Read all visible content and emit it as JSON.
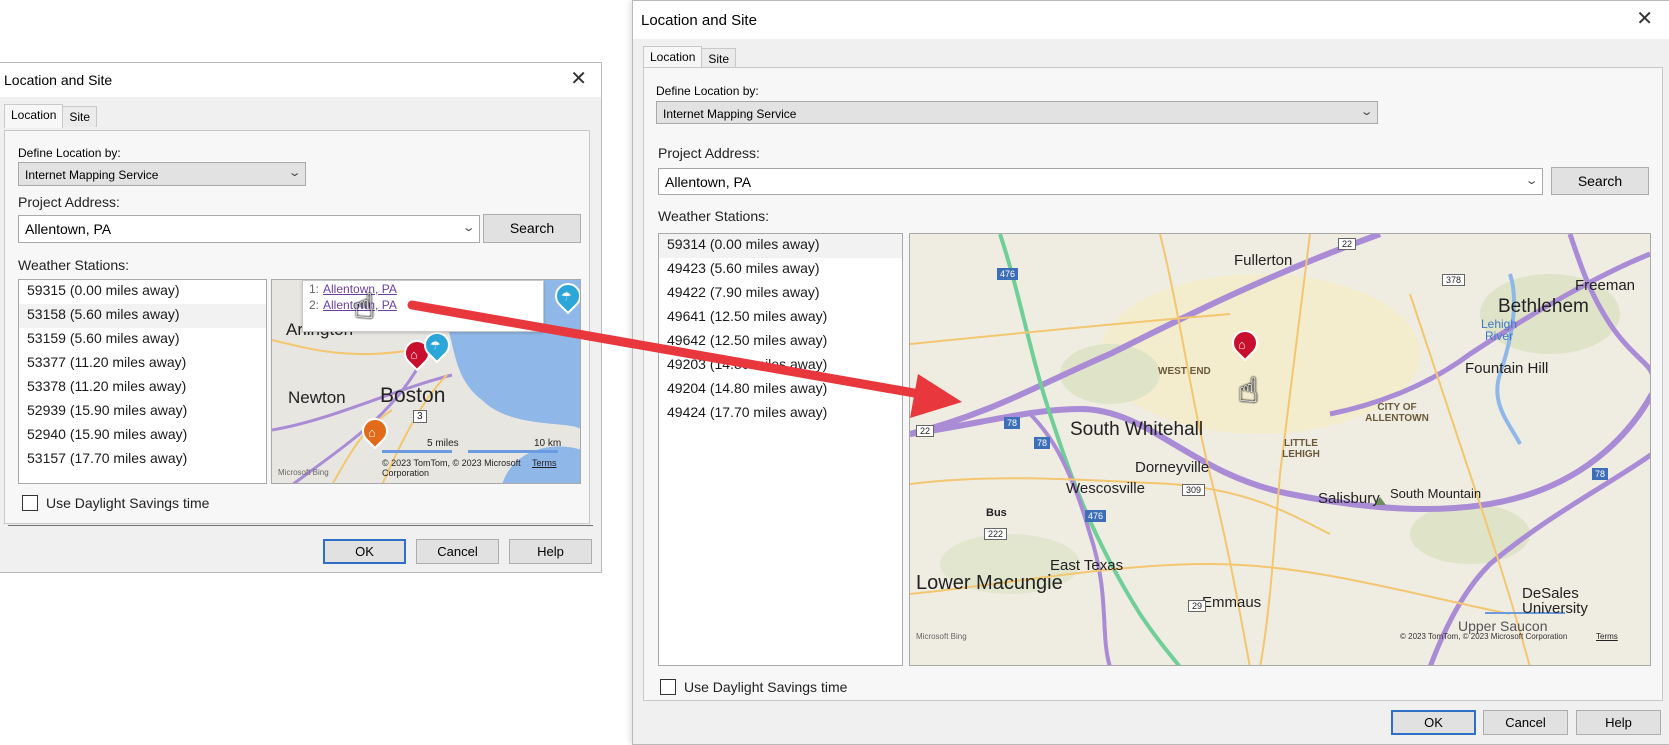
{
  "small": {
    "title": "Location and Site",
    "tabs": [
      "Location",
      "Site"
    ],
    "define_label": "Define Location by:",
    "define_value": "Internet Mapping Service",
    "address_label": "Project Address:",
    "address_value": "Allentown, PA",
    "search_label": "Search",
    "stations_label": "Weather Stations:",
    "stations": [
      "59315 (0.00 miles away)",
      "53158 (5.60 miles away)",
      "53159 (5.60 miles away)",
      "53377 (11.20 miles away)",
      "53378 (11.20 miles away)",
      "52939 (15.90 miles away)",
      "52940 (15.90 miles away)",
      "53157 (17.70 miles away)"
    ],
    "selected_index": 1,
    "daylight_label": "Use Daylight Savings time",
    "ok_label": "OK",
    "cancel_label": "Cancel",
    "help_label": "Help",
    "map": {
      "popup": [
        {
          "num": "1:",
          "text": "Allentown, PA"
        },
        {
          "num": "2:",
          "text": "Allentown, PA"
        }
      ],
      "places": [
        "Arlington",
        "Newton",
        "Boston"
      ],
      "road": "3",
      "scale_miles": "5 miles",
      "scale_km": "10 km",
      "copyright": "© 2023 TomTom, © 2023 Microsoft Corporation",
      "terms": "Terms",
      "brand": "Microsoft Bing"
    }
  },
  "large": {
    "title": "Location and Site",
    "tabs": [
      "Location",
      "Site"
    ],
    "define_label": "Define Location by:",
    "define_value": "Internet Mapping Service",
    "address_label": "Project Address:",
    "address_value": "Allentown, PA",
    "search_label": "Search",
    "stations_label": "Weather Stations:",
    "stations": [
      "59314 (0.00 miles away)",
      "49423 (5.60 miles away)",
      "49422 (7.90 miles away)",
      "49641 (12.50 miles away)",
      "49642 (12.50 miles away)",
      "49203 (14.80 miles away)",
      "49204 (14.80 miles away)",
      "49424 (17.70 miles away)"
    ],
    "selected_index": 0,
    "daylight_label": "Use Daylight Savings time",
    "ok_label": "OK",
    "cancel_label": "Cancel",
    "help_label": "Help",
    "map": {
      "places": {
        "fullerton": "Fullerton",
        "freeman": "Freeman",
        "bethlehem": "Bethlehem",
        "lehigh_river": "Lehigh River",
        "fountain_hill": "Fountain Hill",
        "west_end": "WEST END",
        "city_of_allentown": "CITY OF ALLENTOWN",
        "south_whitehall": "South Whitehall",
        "little_lehigh": "LITTLE LEHIGH",
        "dorneyville": "Dorneyville",
        "wescosville": "Wescosville",
        "salisbury": "Salisbury",
        "south_mountain": "South Mountain",
        "bus": "Bus",
        "east_texas": "East Texas",
        "lower_macungie": "Lower Macungie",
        "emmaus": "Emmaus",
        "desales": "DeSales University",
        "upper_saucon": "Upper Saucon"
      },
      "roads": {
        "r476a": "476",
        "r22a": "22",
        "r378": "378",
        "r22b": "22",
        "r78a": "78",
        "r78b": "78",
        "r309": "309",
        "r476b": "476",
        "r222": "222",
        "r29": "29",
        "r78c": "78"
      },
      "copyright": "© 2023 TomTom, © 2023 Microsoft Corporation",
      "terms": "Terms",
      "brand": "Microsoft Bing"
    }
  },
  "colors": {
    "arrow": "#e8373d",
    "road_purple": "#a98bd6",
    "road_green": "#6fcf97",
    "water": "#8fb8e8",
    "land": "#efece2",
    "pin_red": "#c8102e"
  }
}
